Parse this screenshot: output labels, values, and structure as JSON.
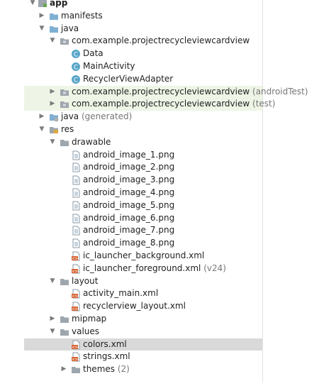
{
  "colors": {
    "test_row_bg": "#eef5e6",
    "selected_row_bg": "#d9d9d9",
    "folder_blue": "#7fb0d3",
    "folder_gray": "#9ea6ad",
    "class_icon": "#58a5c8",
    "xml_icon": "#d9693b"
  },
  "tree": {
    "app": {
      "label": "app",
      "icon": "module-icon"
    },
    "manifests": {
      "label": "manifests",
      "icon": "folder-icon"
    },
    "java": {
      "label": "java",
      "icon": "folder-icon"
    },
    "pkg_main": {
      "label": "com.example.projectrecycleviewcardview",
      "icon": "package-icon"
    },
    "classes": [
      {
        "label": "Data",
        "icon": "class-icon"
      },
      {
        "label": "MainActivity",
        "icon": "class-icon"
      },
      {
        "label": "RecyclerViewAdapter",
        "icon": "class-icon"
      }
    ],
    "pkg_android_test": {
      "label": "com.example.projectrecycleviewcardview",
      "suffix": "(androidTest)",
      "icon": "package-icon"
    },
    "pkg_test": {
      "label": "com.example.projectrecycleviewcardview",
      "suffix": "(test)",
      "icon": "package-icon"
    },
    "java_generated": {
      "label": "java",
      "suffix": "(generated)",
      "icon": "generated-folder-icon"
    },
    "res": {
      "label": "res",
      "icon": "res-folder-icon"
    },
    "drawable": {
      "label": "drawable",
      "icon": "package-icon"
    },
    "drawable_files": [
      {
        "label": "android_image_1.png",
        "icon": "image-file-icon"
      },
      {
        "label": "android_image_2.png",
        "icon": "image-file-icon"
      },
      {
        "label": "android_image_3.png",
        "icon": "image-file-icon"
      },
      {
        "label": "android_image_4.png",
        "icon": "image-file-icon"
      },
      {
        "label": "android_image_5.png",
        "icon": "image-file-icon"
      },
      {
        "label": "android_image_6.png",
        "icon": "image-file-icon"
      },
      {
        "label": "android_image_7.png",
        "icon": "image-file-icon"
      },
      {
        "label": "android_image_8.png",
        "icon": "image-file-icon"
      }
    ],
    "ic_launcher_background": {
      "label": "ic_launcher_background.xml",
      "icon": "xml-file-icon"
    },
    "ic_launcher_foreground": {
      "label": "ic_launcher_foreground.xml",
      "suffix": "(v24)",
      "icon": "xml-file-icon"
    },
    "layout": {
      "label": "layout",
      "icon": "package-icon"
    },
    "layout_files": [
      {
        "label": "activity_main.xml",
        "icon": "xml-file-icon"
      },
      {
        "label": "recyclerview_layout.xml",
        "icon": "xml-file-icon"
      }
    ],
    "mipmap": {
      "label": "mipmap",
      "icon": "package-icon"
    },
    "values": {
      "label": "values",
      "icon": "package-icon"
    },
    "values_files": [
      {
        "label": "colors.xml",
        "icon": "xml-file-icon"
      },
      {
        "label": "strings.xml",
        "icon": "xml-file-icon"
      }
    ],
    "themes": {
      "label": "themes",
      "suffix": "(2)",
      "icon": "package-icon"
    }
  }
}
